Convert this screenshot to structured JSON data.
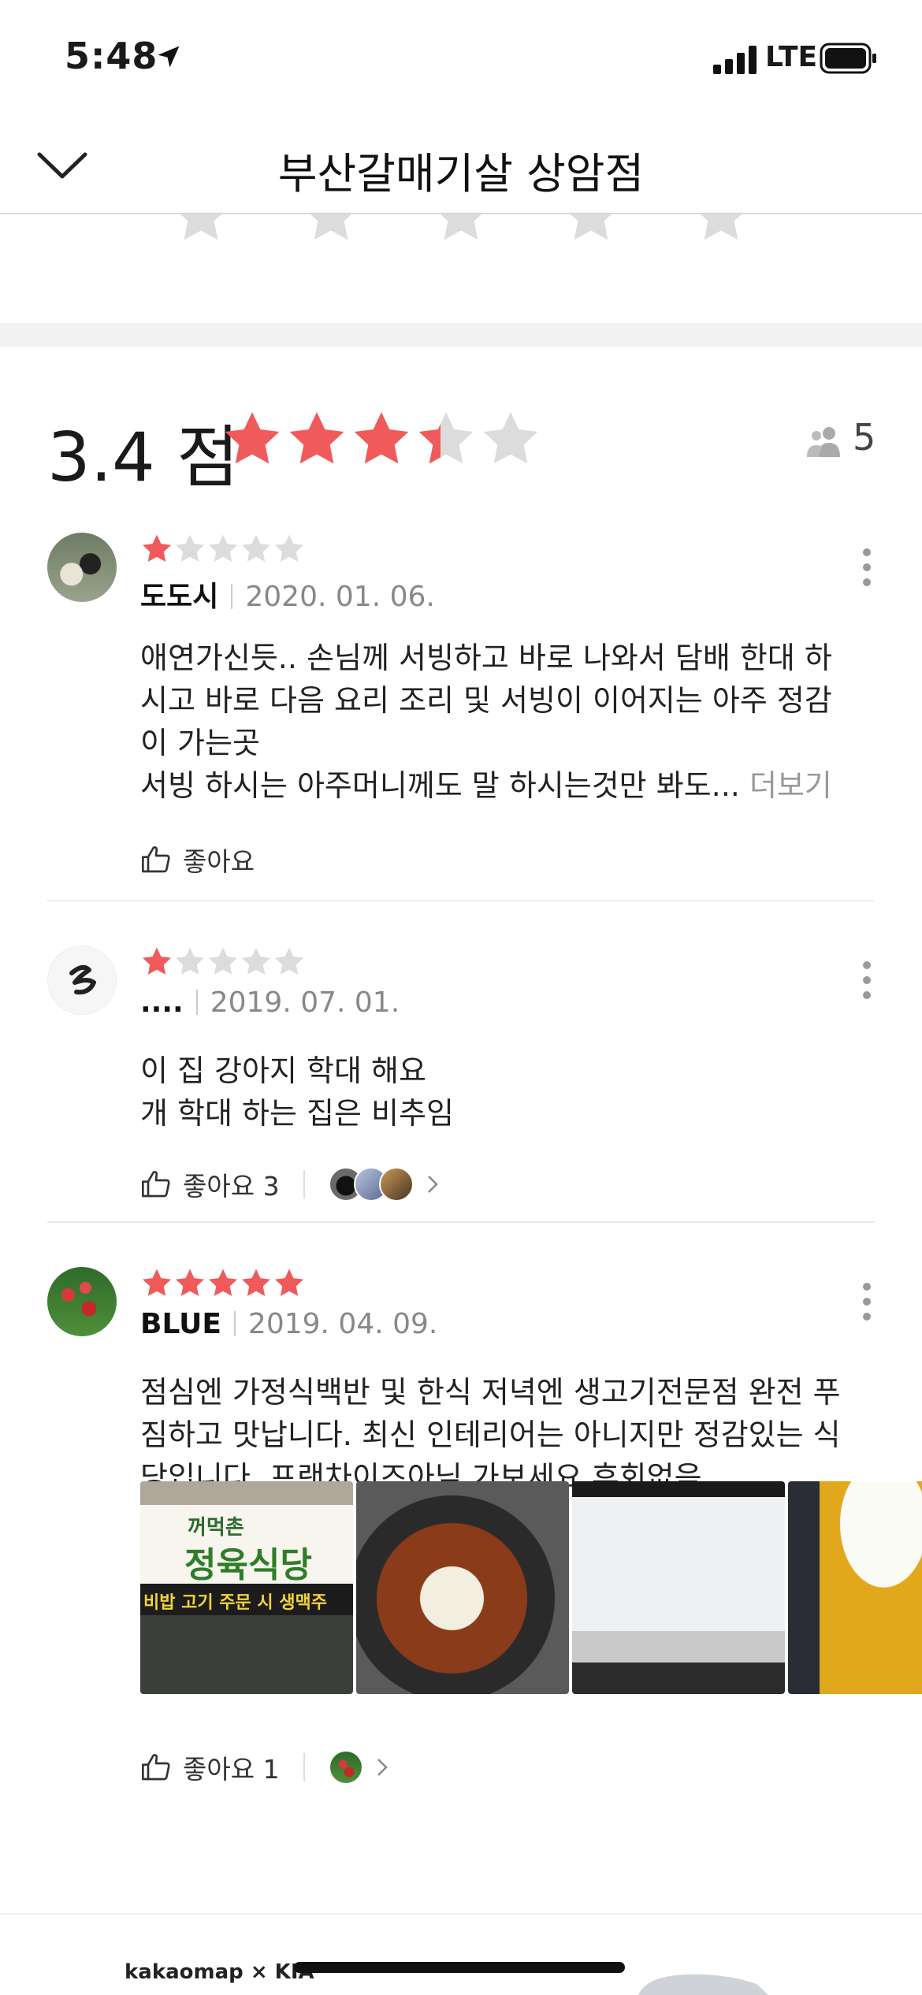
{
  "status_bar": {
    "time": "5:48",
    "network": "LTE"
  },
  "header": {
    "title": "부산갈매기살 상암점"
  },
  "summary": {
    "score": "3.4",
    "score_unit": "점",
    "rating": 3.4,
    "reviewer_count": "5"
  },
  "colors": {
    "star_active": "#f05a5a",
    "star_inactive": "#dcdcdc",
    "accent": "#f05a5a"
  },
  "reviews": [
    {
      "name": "도도시",
      "date": "2020. 01. 06.",
      "rating": 1,
      "text_lines": [
        "애연가신듯.. 손님께 서빙하고 바로 나와서 담배 한대 하",
        "시고 바로 다음 요리 조리 및 서빙이 이어지는 아주 정감",
        "이 가는곳",
        "서빙 하시는 아주머니께도 말 하시는것만 봐도..."
      ],
      "more_label": "더보기",
      "like_label": "좋아요"
    },
    {
      "name": "....",
      "date": "2019. 07. 01.",
      "rating": 1,
      "text_lines": [
        "이 집 강아지 학대 해요",
        "개 학대 하는 집은 비추임"
      ],
      "like_label": "좋아요 3"
    },
    {
      "name": "BLUE",
      "date": "2019. 04. 09.",
      "rating": 5,
      "text_lines": [
        "점심엔 가정식백반 및 한식 저녁엔 생고기전문점 완전 푸",
        "짐하고 맛납니다. 최신 인테리어는 아니지만 정감있는 식",
        "당입니다. 프랜차이즈아님 가보세요 후회없음"
      ],
      "photo_texts": {
        "sign_main": "정육식당",
        "sign_small": "꺼먹촌",
        "sign_band": "비밥  고기 주문 시 생맥주"
      },
      "like_label": "좋아요 1"
    }
  ],
  "footer": {
    "brand": "kakaomap × KIA"
  }
}
